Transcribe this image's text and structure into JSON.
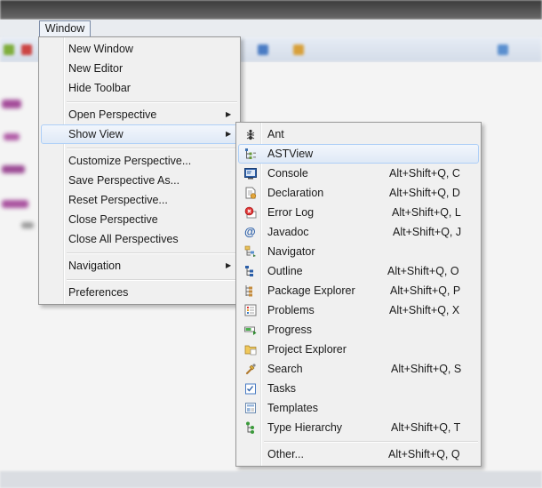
{
  "menubar": {
    "window_label": "Window"
  },
  "window_menu": {
    "items": [
      {
        "label": "New Window"
      },
      {
        "label": "New Editor"
      },
      {
        "label": "Hide Toolbar"
      },
      {
        "label": "Open Perspective"
      },
      {
        "label": "Show View"
      },
      {
        "label": "Customize Perspective..."
      },
      {
        "label": "Save Perspective As..."
      },
      {
        "label": "Reset Perspective..."
      },
      {
        "label": "Close Perspective"
      },
      {
        "label": "Close All Perspectives"
      },
      {
        "label": "Navigation"
      },
      {
        "label": "Preferences"
      }
    ],
    "highlighted": "Show View"
  },
  "show_view_menu": {
    "items": [
      {
        "label": "Ant",
        "shortcut": "",
        "icon": "ant-icon"
      },
      {
        "label": "ASTView",
        "shortcut": "",
        "icon": "astview-icon"
      },
      {
        "label": "Console",
        "shortcut": "Alt+Shift+Q, C",
        "icon": "console-icon"
      },
      {
        "label": "Declaration",
        "shortcut": "Alt+Shift+Q, D",
        "icon": "declaration-icon"
      },
      {
        "label": "Error Log",
        "shortcut": "Alt+Shift+Q, L",
        "icon": "error-log-icon"
      },
      {
        "label": "Javadoc",
        "shortcut": "Alt+Shift+Q, J",
        "icon": "javadoc-icon"
      },
      {
        "label": "Navigator",
        "shortcut": "",
        "icon": "navigator-icon"
      },
      {
        "label": "Outline",
        "shortcut": "Alt+Shift+Q, O",
        "icon": "outline-icon"
      },
      {
        "label": "Package Explorer",
        "shortcut": "Alt+Shift+Q, P",
        "icon": "package-explorer-icon"
      },
      {
        "label": "Problems",
        "shortcut": "Alt+Shift+Q, X",
        "icon": "problems-icon"
      },
      {
        "label": "Progress",
        "shortcut": "",
        "icon": "progress-icon"
      },
      {
        "label": "Project Explorer",
        "shortcut": "",
        "icon": "project-explorer-icon"
      },
      {
        "label": "Search",
        "shortcut": "Alt+Shift+Q, S",
        "icon": "search-icon"
      },
      {
        "label": "Tasks",
        "shortcut": "",
        "icon": "tasks-icon"
      },
      {
        "label": "Templates",
        "shortcut": "",
        "icon": "templates-icon"
      },
      {
        "label": "Type Hierarchy",
        "shortcut": "Alt+Shift+Q, T",
        "icon": "type-hierarchy-icon"
      },
      {
        "label": "Other...",
        "shortcut": "Alt+Shift+Q, Q",
        "icon": ""
      }
    ],
    "highlighted": "ASTView"
  },
  "colors": {
    "highlight_border": "#aecff7",
    "menu_background": "#f0f0f0"
  }
}
